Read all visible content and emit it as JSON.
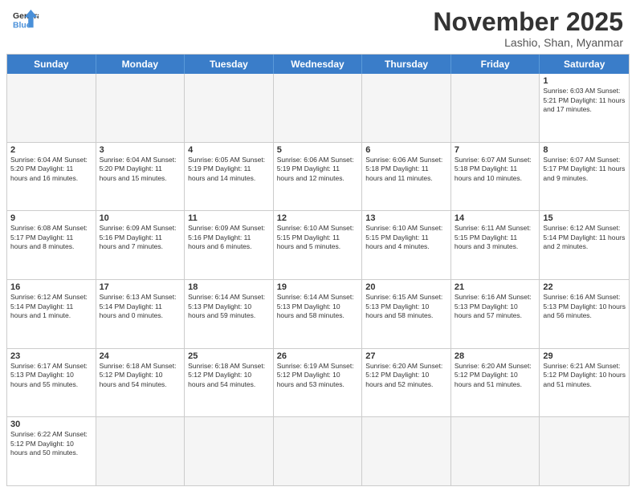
{
  "header": {
    "logo_general": "General",
    "logo_blue": "Blue",
    "month": "November 2025",
    "location": "Lashio, Shan, Myanmar"
  },
  "weekdays": [
    "Sunday",
    "Monday",
    "Tuesday",
    "Wednesday",
    "Thursday",
    "Friday",
    "Saturday"
  ],
  "rows": [
    [
      {
        "day": "",
        "info": "",
        "empty": true
      },
      {
        "day": "",
        "info": "",
        "empty": true
      },
      {
        "day": "",
        "info": "",
        "empty": true
      },
      {
        "day": "",
        "info": "",
        "empty": true
      },
      {
        "day": "",
        "info": "",
        "empty": true
      },
      {
        "day": "",
        "info": "",
        "empty": true
      },
      {
        "day": "1",
        "info": "Sunrise: 6:03 AM\nSunset: 5:21 PM\nDaylight: 11 hours\nand 17 minutes.",
        "empty": false
      }
    ],
    [
      {
        "day": "2",
        "info": "Sunrise: 6:04 AM\nSunset: 5:20 PM\nDaylight: 11 hours\nand 16 minutes.",
        "empty": false
      },
      {
        "day": "3",
        "info": "Sunrise: 6:04 AM\nSunset: 5:20 PM\nDaylight: 11 hours\nand 15 minutes.",
        "empty": false
      },
      {
        "day": "4",
        "info": "Sunrise: 6:05 AM\nSunset: 5:19 PM\nDaylight: 11 hours\nand 14 minutes.",
        "empty": false
      },
      {
        "day": "5",
        "info": "Sunrise: 6:06 AM\nSunset: 5:19 PM\nDaylight: 11 hours\nand 12 minutes.",
        "empty": false
      },
      {
        "day": "6",
        "info": "Sunrise: 6:06 AM\nSunset: 5:18 PM\nDaylight: 11 hours\nand 11 minutes.",
        "empty": false
      },
      {
        "day": "7",
        "info": "Sunrise: 6:07 AM\nSunset: 5:18 PM\nDaylight: 11 hours\nand 10 minutes.",
        "empty": false
      },
      {
        "day": "8",
        "info": "Sunrise: 6:07 AM\nSunset: 5:17 PM\nDaylight: 11 hours\nand 9 minutes.",
        "empty": false
      }
    ],
    [
      {
        "day": "9",
        "info": "Sunrise: 6:08 AM\nSunset: 5:17 PM\nDaylight: 11 hours\nand 8 minutes.",
        "empty": false
      },
      {
        "day": "10",
        "info": "Sunrise: 6:09 AM\nSunset: 5:16 PM\nDaylight: 11 hours\nand 7 minutes.",
        "empty": false
      },
      {
        "day": "11",
        "info": "Sunrise: 6:09 AM\nSunset: 5:16 PM\nDaylight: 11 hours\nand 6 minutes.",
        "empty": false
      },
      {
        "day": "12",
        "info": "Sunrise: 6:10 AM\nSunset: 5:15 PM\nDaylight: 11 hours\nand 5 minutes.",
        "empty": false
      },
      {
        "day": "13",
        "info": "Sunrise: 6:10 AM\nSunset: 5:15 PM\nDaylight: 11 hours\nand 4 minutes.",
        "empty": false
      },
      {
        "day": "14",
        "info": "Sunrise: 6:11 AM\nSunset: 5:15 PM\nDaylight: 11 hours\nand 3 minutes.",
        "empty": false
      },
      {
        "day": "15",
        "info": "Sunrise: 6:12 AM\nSunset: 5:14 PM\nDaylight: 11 hours\nand 2 minutes.",
        "empty": false
      }
    ],
    [
      {
        "day": "16",
        "info": "Sunrise: 6:12 AM\nSunset: 5:14 PM\nDaylight: 11 hours\nand 1 minute.",
        "empty": false
      },
      {
        "day": "17",
        "info": "Sunrise: 6:13 AM\nSunset: 5:14 PM\nDaylight: 11 hours\nand 0 minutes.",
        "empty": false
      },
      {
        "day": "18",
        "info": "Sunrise: 6:14 AM\nSunset: 5:13 PM\nDaylight: 10 hours\nand 59 minutes.",
        "empty": false
      },
      {
        "day": "19",
        "info": "Sunrise: 6:14 AM\nSunset: 5:13 PM\nDaylight: 10 hours\nand 58 minutes.",
        "empty": false
      },
      {
        "day": "20",
        "info": "Sunrise: 6:15 AM\nSunset: 5:13 PM\nDaylight: 10 hours\nand 58 minutes.",
        "empty": false
      },
      {
        "day": "21",
        "info": "Sunrise: 6:16 AM\nSunset: 5:13 PM\nDaylight: 10 hours\nand 57 minutes.",
        "empty": false
      },
      {
        "day": "22",
        "info": "Sunrise: 6:16 AM\nSunset: 5:13 PM\nDaylight: 10 hours\nand 56 minutes.",
        "empty": false
      }
    ],
    [
      {
        "day": "23",
        "info": "Sunrise: 6:17 AM\nSunset: 5:13 PM\nDaylight: 10 hours\nand 55 minutes.",
        "empty": false
      },
      {
        "day": "24",
        "info": "Sunrise: 6:18 AM\nSunset: 5:12 PM\nDaylight: 10 hours\nand 54 minutes.",
        "empty": false
      },
      {
        "day": "25",
        "info": "Sunrise: 6:18 AM\nSunset: 5:12 PM\nDaylight: 10 hours\nand 54 minutes.",
        "empty": false
      },
      {
        "day": "26",
        "info": "Sunrise: 6:19 AM\nSunset: 5:12 PM\nDaylight: 10 hours\nand 53 minutes.",
        "empty": false
      },
      {
        "day": "27",
        "info": "Sunrise: 6:20 AM\nSunset: 5:12 PM\nDaylight: 10 hours\nand 52 minutes.",
        "empty": false
      },
      {
        "day": "28",
        "info": "Sunrise: 6:20 AM\nSunset: 5:12 PM\nDaylight: 10 hours\nand 51 minutes.",
        "empty": false
      },
      {
        "day": "29",
        "info": "Sunrise: 6:21 AM\nSunset: 5:12 PM\nDaylight: 10 hours\nand 51 minutes.",
        "empty": false
      }
    ],
    [
      {
        "day": "30",
        "info": "Sunrise: 6:22 AM\nSunset: 5:12 PM\nDaylight: 10 hours\nand 50 minutes.",
        "empty": false
      },
      {
        "day": "",
        "info": "",
        "empty": true
      },
      {
        "day": "",
        "info": "",
        "empty": true
      },
      {
        "day": "",
        "info": "",
        "empty": true
      },
      {
        "day": "",
        "info": "",
        "empty": true
      },
      {
        "day": "",
        "info": "",
        "empty": true
      },
      {
        "day": "",
        "info": "",
        "empty": true
      }
    ]
  ]
}
